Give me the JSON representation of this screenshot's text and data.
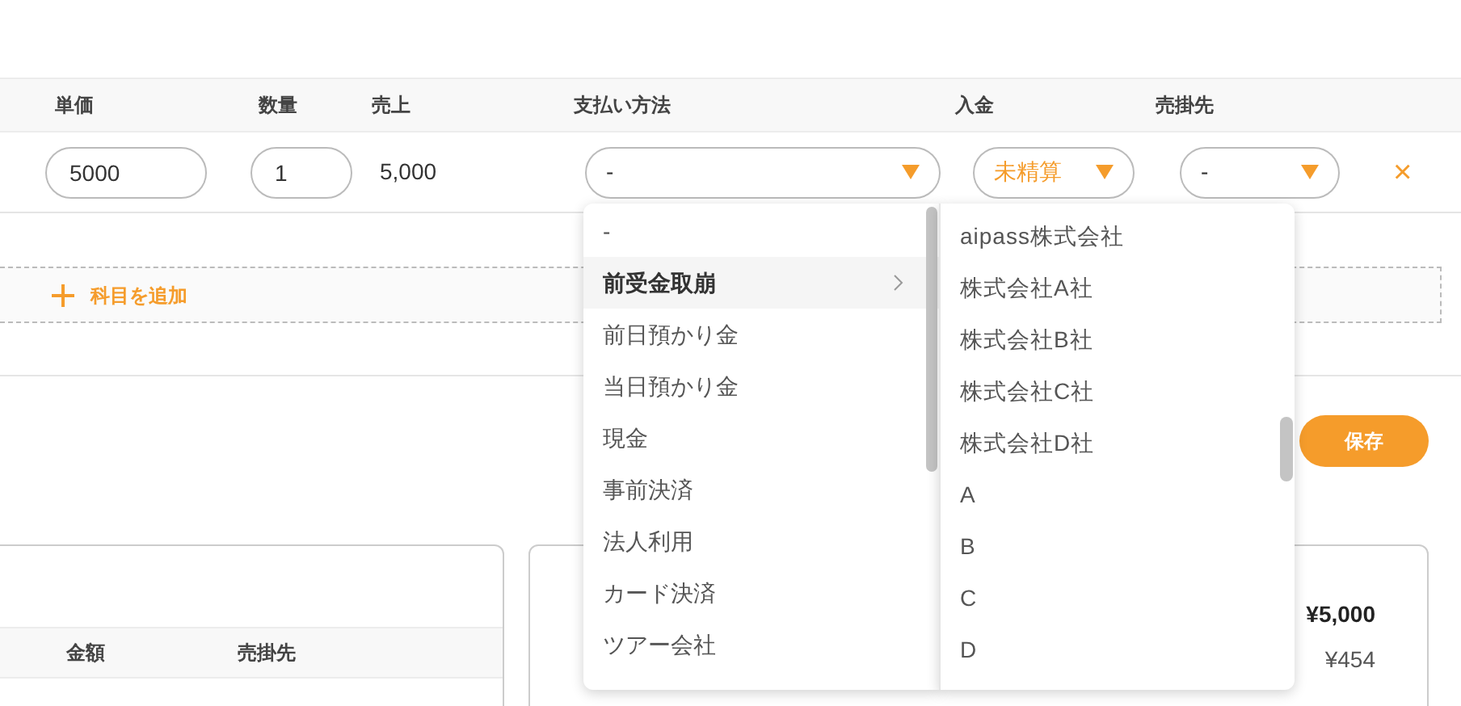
{
  "table": {
    "columns": [
      "単価",
      "数量",
      "売上",
      "支払い方法",
      "入金",
      "売掛先"
    ],
    "rows": [
      {
        "unit_price": "5000",
        "quantity": "1",
        "sales": "5,000",
        "payment_method": "-",
        "payment_status": "未精算",
        "receivable": "-",
        "delete": "×"
      }
    ]
  },
  "add_item": {
    "label": "科目を追加"
  },
  "save_button": "保存",
  "payment_menu": {
    "items": [
      {
        "label": "-",
        "selected": false,
        "has_submenu": false
      },
      {
        "label": "前受金取崩",
        "selected": true,
        "has_submenu": true
      },
      {
        "label": "前日預かり金",
        "selected": false,
        "has_submenu": false
      },
      {
        "label": "当日預かり金",
        "selected": false,
        "has_submenu": false
      },
      {
        "label": "現金",
        "selected": false,
        "has_submenu": false
      },
      {
        "label": "事前決済",
        "selected": false,
        "has_submenu": false
      },
      {
        "label": "法人利用",
        "selected": false,
        "has_submenu": false
      },
      {
        "label": "カード決済",
        "selected": false,
        "has_submenu": false
      },
      {
        "label": "ツアー会社",
        "selected": false,
        "has_submenu": false
      }
    ]
  },
  "submenu": {
    "items": [
      {
        "label": "aipass株式会社"
      },
      {
        "label": "株式会社A社"
      },
      {
        "label": "株式会社B社"
      },
      {
        "label": "株式会社C社"
      },
      {
        "label": "株式会社D社"
      },
      {
        "label": "A"
      },
      {
        "label": "B"
      },
      {
        "label": "C"
      },
      {
        "label": "D"
      }
    ]
  },
  "left_card": {
    "columns": [
      "金額",
      "売掛先"
    ]
  },
  "right_card": {
    "rows": [
      {
        "value": "¥5,000",
        "bold": true
      },
      {
        "value": "¥454",
        "bold": false
      }
    ]
  }
}
